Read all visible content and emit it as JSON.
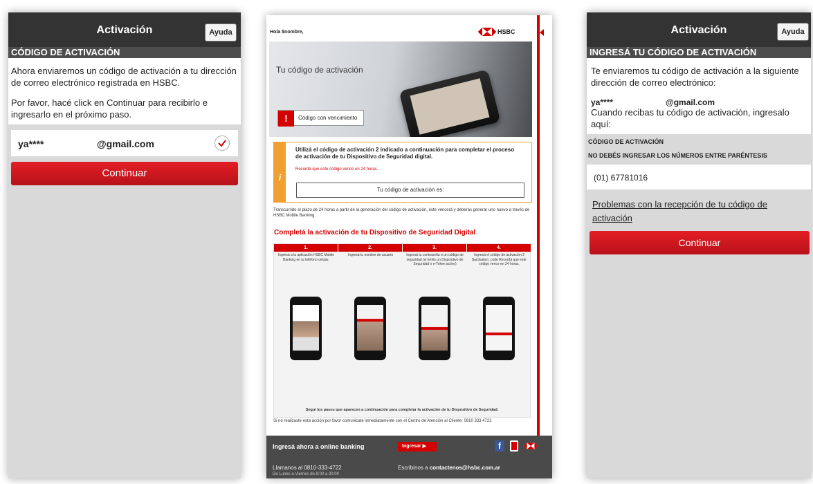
{
  "left_screen": {
    "title": "Activación",
    "help_label": "Ayuda",
    "section_title": "CÓDIGO DE ACTIVACIÓN",
    "paragraph_1": "Ahora enviaremos un código de activación a tu dirección de correo electrónico registrada en HSBC.",
    "paragraph_2": "Por favor, hacé click en Continuar para recibirlo e ingresarlo en el próximo paso.",
    "email_user": "ya****",
    "email_domain": "@gmail.com",
    "continue_label": "Continuar"
  },
  "email": {
    "greeting": "Hola $nombre,",
    "brand": "HSBC",
    "hero_title": "Tu código de activación",
    "badge_label": "Código con vencimiento",
    "notice_text": "Utilizá el código de activación 2 indicado a continuación para completar el proceso de activación de tu Dispositivo de Seguridad digital.",
    "notice_warning": "Recordá que este código vence en 24 horas.",
    "code_box_label": "Tu código de activación es:",
    "expiry_paragraph": "Transcurrido el plazo de 24 horas a partir de la generación del código de activación, éste vencerá y deberás generar uno nuevo a través de HSBC Mobile Banking.",
    "steps_heading": "Completá la activación de tu Dispositivo de Seguridad Digital",
    "steps": [
      {
        "number": "1.",
        "text": "Ingresá a la aplicación HSBC Mobile Banking en tu teléfono celular."
      },
      {
        "number": "2.",
        "text": "Ingresá tu nombre de usuario"
      },
      {
        "number": "3.",
        "text": "Ingresá tu contraseña o un código de seguridad (si tenés un Dispositivo de Seguridad o e-Token activo)"
      },
      {
        "number": "4.",
        "text": "Ingresá el código de activación 2 $activation_code  Recordá que este código vence en 24 horas."
      }
    ],
    "steps_footer": "Seguí los pasos que aparecen a continuación para completar la activación de tu Dispositivo de Seguridad.",
    "contact_text": "Si no realizaste esta acción por favor comunicate inmediatamente con el Centro de Atención al Cliente: 0810 333 4722",
    "footer": {
      "online_banking": "Ingresá ahora a online banking",
      "login_button": "Ingresar",
      "phone_line": "Llamanos al 0810-333-4722",
      "hours_line": "De Lunes a Viernes de 8:00 a 20:00",
      "write_prefix": "Escribinos a",
      "write_email": "contactenos@hsbc.com.ar",
      "facebook_icon": "f"
    }
  },
  "right_screen": {
    "title": "Activación",
    "help_label": "Ayuda",
    "section_title": "INGRESÁ TU CÓDIGO DE ACTIVACIÓN",
    "paragraph_1": "Te enviaremos tu código de activación a la siguiente dirección de correo electrónico:",
    "email_user": "ya****",
    "email_domain": "@gmail.com",
    "paragraph_2": "Cuando recibas tu código de activación, ingresalo aquí:",
    "code_label": "CÓDIGO DE ACTIVACIÓN",
    "code_hint": "NO DEBÉS INGRESAR LOS NÚMEROS ENTRE PARÉNTESIS",
    "code_value": "(01) 67781016",
    "problems_link": "Problemas con la recepción de tu código de activación",
    "continue_label": "Continuar"
  },
  "colors": {
    "header": "#333333",
    "section_bar": "#4d4d4d",
    "brand_red": "#d40000",
    "panel_gray": "#d9d9d9"
  }
}
